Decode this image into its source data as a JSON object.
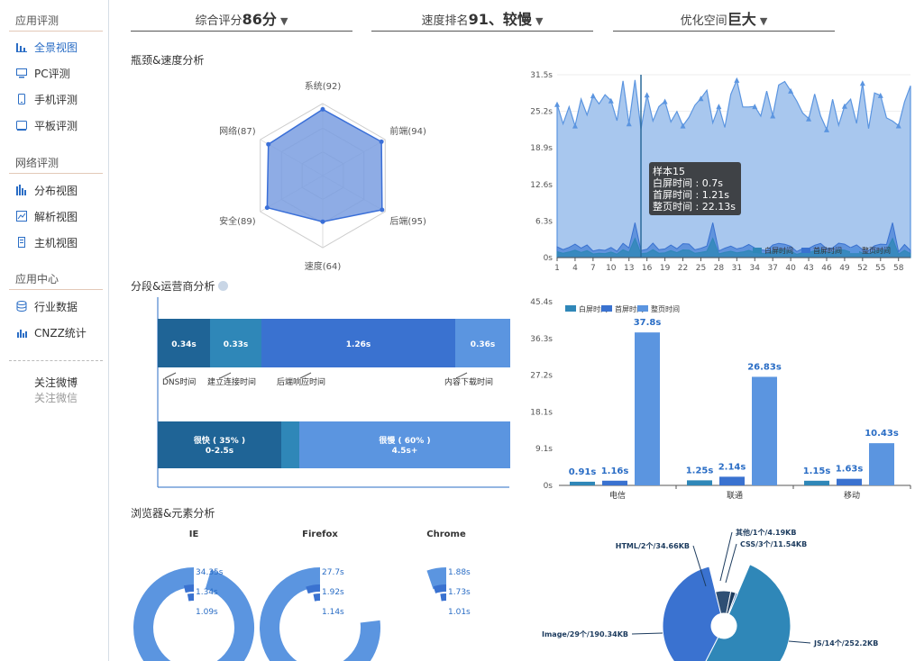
{
  "sidebar": {
    "sections": [
      {
        "title": "应用评测",
        "items": [
          "全景视图",
          "PC评测",
          "手机评测",
          "平板评测"
        ]
      },
      {
        "title": "网络评测",
        "items": [
          "分布视图",
          "解析视图",
          "主机视图"
        ]
      },
      {
        "title": "应用中心",
        "items": [
          "行业数据",
          "CNZZ统计"
        ]
      }
    ],
    "follow": [
      "关注微博",
      "关注微信"
    ]
  },
  "scores": [
    {
      "label": "综合评分",
      "value": "86分"
    },
    {
      "label": "速度排名",
      "value": "91、较慢"
    },
    {
      "label": "优化空间",
      "value": "巨大"
    }
  ],
  "titles": {
    "radar": "瓶颈&速度分析",
    "segment": "分段&运营商分析",
    "browser": "浏览器&元素分析"
  },
  "radar": {
    "axes": [
      {
        "name": "系统",
        "value": 92
      },
      {
        "name": "前端",
        "value": 94
      },
      {
        "name": "后端",
        "value": 95
      },
      {
        "name": "速度",
        "value": 64
      },
      {
        "name": "安全",
        "value": 89
      },
      {
        "name": "网络",
        "value": 87
      }
    ],
    "max": 100,
    "fill": "#7a9ee0",
    "stroke": "#3a6fd8"
  },
  "area": {
    "yticks": [
      "31.5s",
      "25.2s",
      "18.9s",
      "12.6s",
      "6.3s",
      "0s"
    ],
    "xticks": [
      "1",
      "4",
      "7",
      "10",
      "13",
      "16",
      "19",
      "22",
      "25",
      "28",
      "31",
      "34",
      "37",
      "40",
      "43",
      "46",
      "49",
      "52",
      "55",
      "58"
    ],
    "legend": [
      "白屏时间",
      "首屏时间",
      "整页时间"
    ],
    "tooltip": {
      "title": "样本15",
      "lines": [
        "白屏时间 : 0.7s",
        "首屏时间 : 1.21s",
        "整页时间 : 22.13s"
      ]
    }
  },
  "segment": {
    "bar1": [
      {
        "value": "0.34s",
        "label": "DNS时间",
        "color": "#1f6496"
      },
      {
        "value": "0.33s",
        "label": "建立连接时间",
        "color": "#2f87b8"
      },
      {
        "value": "1.26s",
        "label": "后端响应时间",
        "color": "#3a72d0"
      },
      {
        "value": "0.36s",
        "label": "内容下载时间",
        "color": "#5b95e0"
      }
    ],
    "bar2": [
      {
        "line1": "很快 ( 35% )",
        "line2": "0-2.5s",
        "color": "#1f6496"
      },
      {
        "line1": "",
        "line2": "",
        "color": "#2f87b8"
      },
      {
        "line1": "很慢 ( 60% )",
        "line2": "4.5s+",
        "color": "#5b95e0"
      }
    ]
  },
  "chart_data": [
    {
      "type": "bar",
      "categories": [
        "电信",
        "联通",
        "移动"
      ],
      "series": [
        {
          "name": "白屏时间",
          "values": [
            0.91,
            1.25,
            1.15
          ]
        },
        {
          "name": "首屏时间",
          "values": [
            1.16,
            2.14,
            1.63
          ]
        },
        {
          "name": "整页时间",
          "values": [
            37.8,
            26.83,
            10.43
          ]
        }
      ],
      "value_labels": [
        [
          "0.91s",
          "1.16s",
          "37.8s"
        ],
        [
          "1.25s",
          "2.14s",
          "26.83s"
        ],
        [
          "1.15s",
          "1.63s",
          "10.43s"
        ]
      ],
      "yticks": [
        "45.4s",
        "36.3s",
        "27.2s",
        "18.1s",
        "9.1s",
        "0s"
      ],
      "ylim": [
        0,
        45.4
      ],
      "colors": [
        "#2f87b8",
        "#3a72d0",
        "#5b95e0"
      ]
    },
    {
      "type": "pie",
      "labels": [
        "JS/14个/252.2KB",
        "Image/29个/190.34KB",
        "HTML/2个/34.66KB",
        "CSS/3个/11.54KB",
        "其他/1个/4.19KB"
      ],
      "values": [
        252.2,
        190.34,
        34.66,
        11.54,
        4.19
      ],
      "colors": [
        "#2f87b8",
        "#3a72d0",
        "#2e4f74",
        "#1c3b5e",
        "#4a7fc4"
      ]
    }
  ],
  "browsers": [
    {
      "name": "IE",
      "values": [
        "34.35s",
        "1.34s",
        "1.09s"
      ]
    },
    {
      "name": "Firefox",
      "values": [
        "27.7s",
        "1.92s",
        "1.14s"
      ]
    },
    {
      "name": "Chrome",
      "values": [
        "1.88s",
        "1.73s",
        "1.01s"
      ]
    }
  ]
}
